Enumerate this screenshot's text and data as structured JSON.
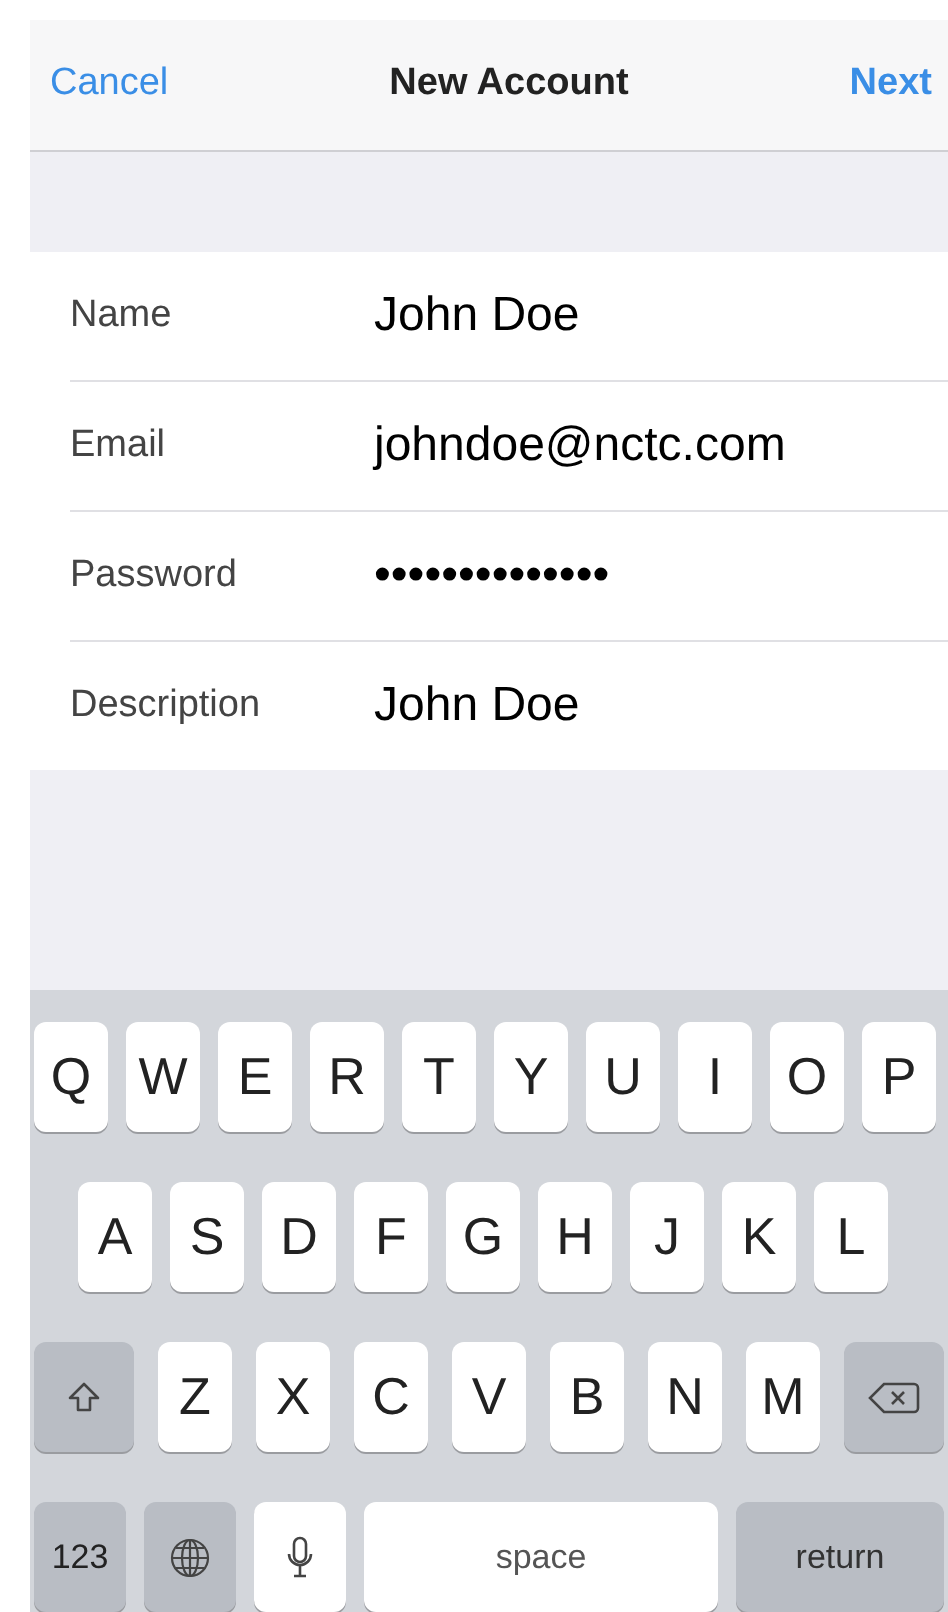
{
  "nav_bar": {
    "cancel": "Cancel",
    "title": "New Account",
    "next": "Next"
  },
  "form": [
    {
      "label": "Name",
      "value": "John Doe"
    },
    {
      "label": "Email",
      "value": "johndoe@nctc.com"
    },
    {
      "label": "Password",
      "value": "••••••••••••••"
    },
    {
      "label": "Description",
      "value": "John Doe"
    }
  ],
  "keyboard": [
    [
      {
        "kind": "letter",
        "text": "Q"
      },
      {
        "kind": "letter",
        "text": "W"
      },
      {
        "kind": "letter",
        "text": "E"
      },
      {
        "kind": "letter",
        "text": "R"
      },
      {
        "kind": "letter",
        "text": "T"
      },
      {
        "kind": "letter",
        "text": "Y"
      },
      {
        "kind": "letter",
        "text": "U"
      },
      {
        "kind": "letter",
        "text": "I"
      },
      {
        "kind": "letter",
        "text": "O"
      },
      {
        "kind": "letter",
        "text": "P"
      }
    ],
    [
      {
        "kind": "letter",
        "text": "A"
      },
      {
        "kind": "letter",
        "text": "S"
      },
      {
        "kind": "letter",
        "text": "D"
      },
      {
        "kind": "letter",
        "text": "F"
      },
      {
        "kind": "letter",
        "text": "G"
      },
      {
        "kind": "letter",
        "text": "H"
      },
      {
        "kind": "letter",
        "text": "J"
      },
      {
        "kind": "letter",
        "text": "K"
      },
      {
        "kind": "letter",
        "text": "L"
      }
    ],
    [
      {
        "kind": "shift"
      },
      {
        "kind": "letter",
        "text": "Z"
      },
      {
        "kind": "letter",
        "text": "X"
      },
      {
        "kind": "letter",
        "text": "C"
      },
      {
        "kind": "letter",
        "text": "V"
      },
      {
        "kind": "letter",
        "text": "B"
      },
      {
        "kind": "letter",
        "text": "N"
      },
      {
        "kind": "letter",
        "text": "M"
      },
      {
        "kind": "delete"
      }
    ],
    [
      {
        "kind": "numbers",
        "text": "123"
      },
      {
        "kind": "globe"
      },
      {
        "kind": "mic"
      },
      {
        "kind": "space",
        "text": "space"
      },
      {
        "kind": "return",
        "text": "return"
      }
    ]
  ]
}
